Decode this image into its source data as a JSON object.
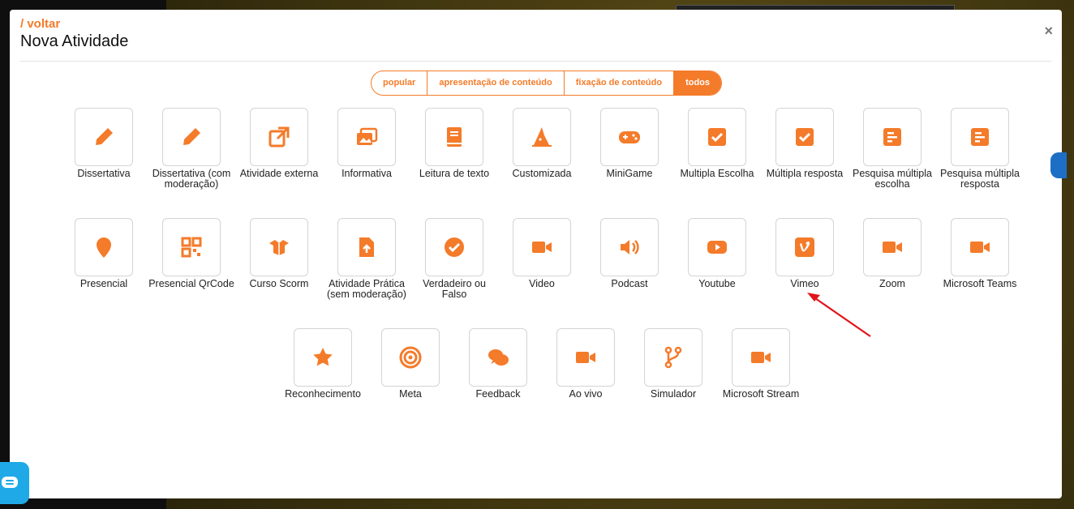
{
  "header": {
    "back_label": "/ voltar",
    "title": "Nova Atividade",
    "close_label": "×"
  },
  "filters": [
    {
      "label": "popular",
      "active": false
    },
    {
      "label": "apresentação de conteúdo",
      "active": false
    },
    {
      "label": "fixação de conteúdo",
      "active": false
    },
    {
      "label": "todos",
      "active": true
    }
  ],
  "accent_color": "#f47b2a",
  "activities": [
    {
      "label": "Dissertativa",
      "icon": "pencil-icon"
    },
    {
      "label": "Dissertativa (com moderação)",
      "icon": "pencil-icon"
    },
    {
      "label": "Atividade externa",
      "icon": "external-link-icon"
    },
    {
      "label": "Informativa",
      "icon": "images-icon"
    },
    {
      "label": "Leitura de texto",
      "icon": "book-icon"
    },
    {
      "label": "Customizada",
      "icon": "wizard-hat-icon"
    },
    {
      "label": "MiniGame",
      "icon": "gamepad-icon"
    },
    {
      "label": "Multipla Escolha",
      "icon": "checkbox-icon"
    },
    {
      "label": "Múltipla resposta",
      "icon": "checkbox-icon"
    },
    {
      "label": "Pesquisa múltipla escolha",
      "icon": "poll-icon"
    },
    {
      "label": "Pesquisa múltipla resposta",
      "icon": "poll-icon"
    },
    {
      "label": "Presencial",
      "icon": "map-pin-icon"
    },
    {
      "label": "Presencial QrCode",
      "icon": "qrcode-icon"
    },
    {
      "label": "Curso Scorm",
      "icon": "box-open-icon"
    },
    {
      "label": "Atividade Prática (sem moderação)",
      "icon": "file-upload-icon"
    },
    {
      "label": "Verdadeiro ou Falso",
      "icon": "check-circle-icon"
    },
    {
      "label": "Video",
      "icon": "video-icon"
    },
    {
      "label": "Podcast",
      "icon": "speaker-icon"
    },
    {
      "label": "Youtube",
      "icon": "youtube-icon"
    },
    {
      "label": "Vimeo",
      "icon": "vimeo-icon"
    },
    {
      "label": "Zoom",
      "icon": "video-icon"
    },
    {
      "label": "Microsoft Teams",
      "icon": "video-icon"
    },
    {
      "label": "Reconhecimento",
      "icon": "star-icon"
    },
    {
      "label": "Meta",
      "icon": "target-icon"
    },
    {
      "label": "Feedback",
      "icon": "comments-icon"
    },
    {
      "label": "Ao vivo",
      "icon": "video-icon"
    },
    {
      "label": "Simulador",
      "icon": "code-branch-icon"
    },
    {
      "label": "Microsoft Stream",
      "icon": "video-icon"
    }
  ]
}
